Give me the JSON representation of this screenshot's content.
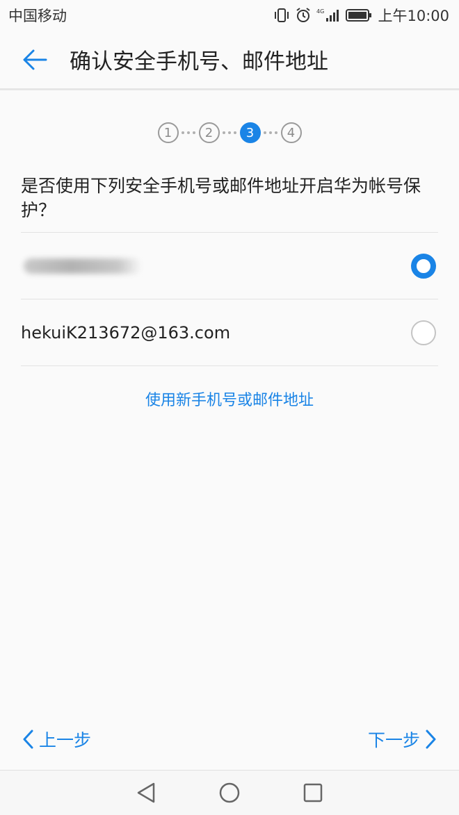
{
  "status_bar": {
    "carrier": "中国移动",
    "network": "4G",
    "time": "上午10:00"
  },
  "header": {
    "title": "确认安全手机号、邮件地址"
  },
  "steps": {
    "items": [
      "1",
      "2",
      "3",
      "4"
    ],
    "current": 3
  },
  "question": "是否使用下列安全手机号或邮件地址开启华为帐号保护？",
  "options": [
    {
      "label": "",
      "masked": true,
      "selected": true
    },
    {
      "label": "hekuiK213672@163.com",
      "masked": false,
      "selected": false
    }
  ],
  "new_contact_link": "使用新手机号或邮件地址",
  "footer": {
    "prev_label": "上一步",
    "next_label": "下一步"
  },
  "colors": {
    "accent": "#1a84e6"
  }
}
